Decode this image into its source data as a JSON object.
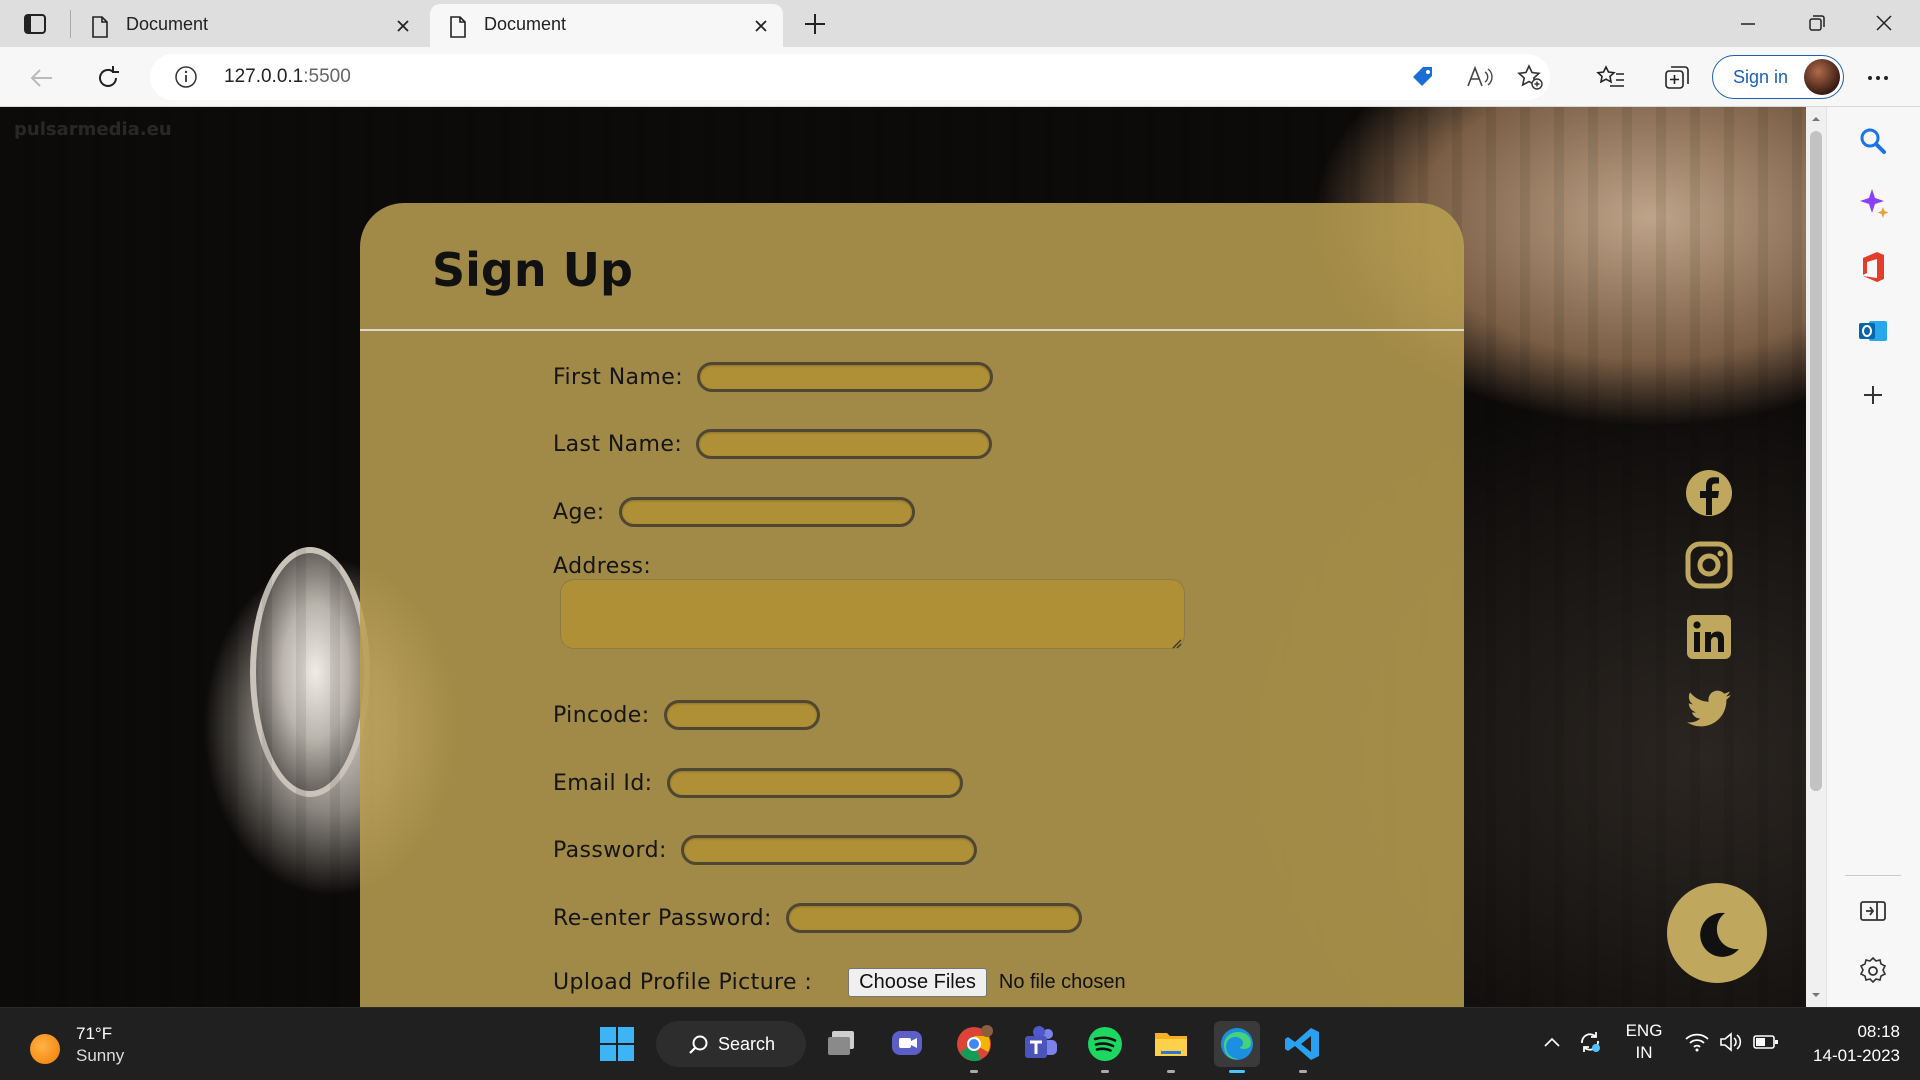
{
  "browser": {
    "tabs": [
      {
        "title": "Document",
        "active": false
      },
      {
        "title": "Document",
        "active": true
      }
    ],
    "address": {
      "host": "127.0.0.1",
      "port": ":5500"
    },
    "signin_label": "Sign in"
  },
  "page": {
    "watermark": "pulsarmedia.eu",
    "form": {
      "title": "Sign Up",
      "fields": [
        {
          "label": "First Name:",
          "value": ""
        },
        {
          "label": "Last Name:",
          "value": ""
        },
        {
          "label": "Age:",
          "value": ""
        },
        {
          "label": "Address:",
          "value": ""
        },
        {
          "label": "Pincode:",
          "value": ""
        },
        {
          "label": "Email Id:",
          "value": ""
        },
        {
          "label": "Password:",
          "value": ""
        },
        {
          "label": "Re-enter Password:",
          "value": ""
        }
      ],
      "upload": {
        "label": "Upload Profile Picture :",
        "button": "Choose Files",
        "status": "No file chosen"
      }
    },
    "socials": [
      "facebook-icon",
      "instagram-icon",
      "linkedin-icon",
      "twitter-icon"
    ],
    "theme_toggle_icon": "moon-icon",
    "colors": {
      "card": "#baa052",
      "field": "#b09036",
      "accent": "#1a5fb4"
    }
  },
  "taskbar": {
    "weather": {
      "temp": "71°F",
      "condition": "Sunny"
    },
    "search_label": "Search",
    "language": {
      "line1": "ENG",
      "line2": "IN"
    },
    "clock": {
      "time": "08:18",
      "date": "14-01-2023"
    }
  }
}
